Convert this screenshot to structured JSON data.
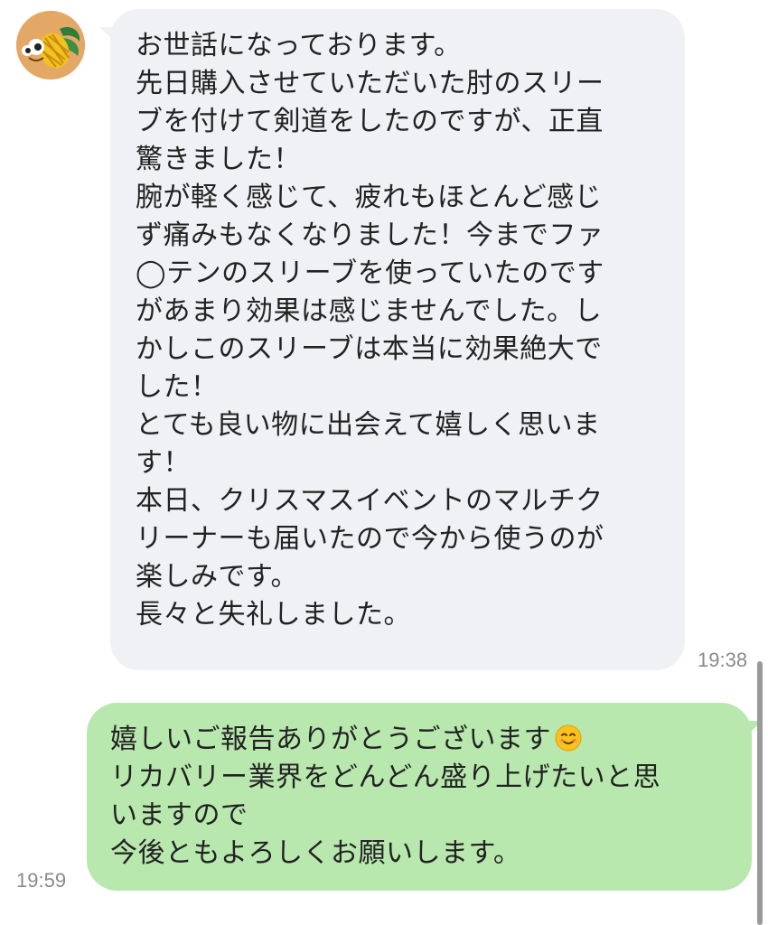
{
  "conversation": {
    "incoming": {
      "avatar_icon": "pineapple-avatar-icon",
      "bubble_color": "#f0f1f4",
      "lines": [
        "お世話になっております。",
        "先日購入させていただいた肘のスリー",
        "ブを付けて剣道をしたのですが、正直",
        "驚きました！",
        "腕が軽く感じて、疲れもほとんど感じ",
        "ず痛みもなくなりました！今までファ",
        "◯テンのスリーブを使っていたのです",
        "があまり効果は感じませんでした。し",
        "かしこのスリーブは本当に効果絶大で",
        "した！",
        "とても良い物に出会えて嬉しく思いま",
        "す！",
        "本日、クリスマスイベントのマルチク",
        "リーナーも届いたので今から使うのが",
        "楽しみです。",
        "長々と失礼しました。"
      ],
      "time": "19:38"
    },
    "outgoing": {
      "bubble_color": "#b8e8ae",
      "lines": [
        "嬉しいご報告ありがとうございます",
        "リカバリー業界をどんどん盛り上げたいと思",
        "いますので",
        "今後ともよろしくお願いします。"
      ],
      "emoji_icon": "smiling-face-emoji-icon",
      "time": "19:59"
    }
  }
}
